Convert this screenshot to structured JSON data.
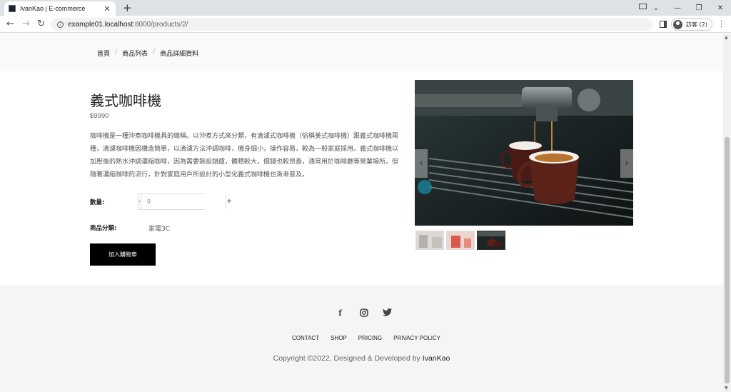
{
  "browser": {
    "tab_title": "IvanKao | E-commerce",
    "url_host": "example01.localhost",
    "url_path": ":8000/products/2/",
    "profile_label": "訪客 (2)"
  },
  "breadcrumb": {
    "home": "首頁",
    "products": "商品列表",
    "detail": "商品詳細資料"
  },
  "product": {
    "title": "義式咖啡機",
    "price": "$9990",
    "description": "咖啡機是一種沖煮咖啡機具的總稱。以沖煮方式來分類，有滴濾式咖啡機（俗稱美式咖啡機）跟義式咖啡機兩種，滴濾咖啡機因構造簡單，以滴濾方法沖調咖啡，機身細小，操作容易，較為一般家庭採用。義式咖啡機以加壓後的熱水沖調濃縮咖啡，因為需要裝設鍋爐，體積較大，價錢也較昂貴，通常用於咖啡廳等營業場所。但隨著濃縮咖啡的流行，針對家庭用戶所設計的小型化義式咖啡機也漸漸普及。",
    "quantity_label": "數量:",
    "quantity_minus": "-",
    "quantity_plus": "+",
    "quantity_value": "0",
    "category_label": "商品分類:",
    "category_value": "家電3C",
    "add_to_cart": "加入購物車"
  },
  "footer": {
    "nav": [
      "CONTACT",
      "SHOP",
      "PRICING",
      "PRIVACY POLICY"
    ],
    "copyright_prefix": "Copyright ©2022, Designed & Developed by ",
    "copyright_author": "IvanKao"
  }
}
